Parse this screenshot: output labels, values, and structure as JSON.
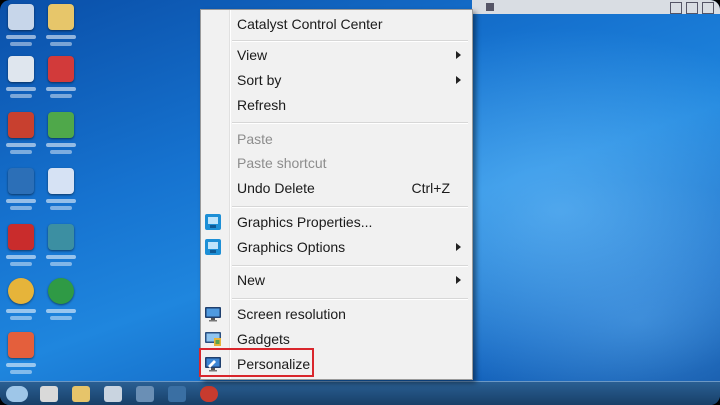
{
  "desktop": {
    "icons": [
      {
        "name": "computer-icon",
        "color": "#c7d6ea"
      },
      {
        "name": "folder-icon",
        "color": "#e7c66a"
      },
      {
        "name": "recycle-bin-icon",
        "color": "#dfe6ee"
      },
      {
        "name": "app-icon-red",
        "color": "#c8402f"
      },
      {
        "name": "app-icon-red-2",
        "color": "#d23a3a"
      },
      {
        "name": "app-icon-green",
        "color": "#4fa84a"
      },
      {
        "name": "app-icon-blue",
        "color": "#2c6fb7"
      },
      {
        "name": "mail-icon",
        "color": "#d6e2f4"
      },
      {
        "name": "app-icon-red-3",
        "color": "#c92c2c"
      },
      {
        "name": "app-icon-teal",
        "color": "#3c8fa2"
      },
      {
        "name": "chrome-icon",
        "color": "#e6b43a"
      },
      {
        "name": "app-icon-green-2",
        "color": "#2f9a45"
      },
      {
        "name": "app-icon-multicolor",
        "color": "#e45f3c"
      }
    ]
  },
  "context_menu": {
    "header": {
      "label": "Catalyst Control Center"
    },
    "view": {
      "label": "View",
      "has_submenu": true
    },
    "sort_by": {
      "label": "Sort by",
      "has_submenu": true
    },
    "refresh": {
      "label": "Refresh"
    },
    "paste": {
      "label": "Paste",
      "disabled": true
    },
    "paste_shortcut": {
      "label": "Paste shortcut",
      "disabled": true
    },
    "undo_delete": {
      "label": "Undo Delete",
      "shortcut": "Ctrl+Z"
    },
    "graphics_properties": {
      "label": "Graphics Properties...",
      "icon": "graphics-icon"
    },
    "graphics_options": {
      "label": "Graphics Options",
      "icon": "graphics-icon",
      "has_submenu": true
    },
    "new": {
      "label": "New",
      "has_submenu": true
    },
    "screen_resolution": {
      "label": "Screen resolution",
      "icon": "monitor-icon"
    },
    "gadgets": {
      "label": "Gadgets",
      "icon": "gadgets-icon"
    },
    "personalize": {
      "label": "Personalize",
      "icon": "personalize-icon",
      "highlighted": true
    }
  },
  "colors": {
    "highlight_box": "#d9262c",
    "graphics_icon": "#1d8fd6",
    "monitor_icon": "#2a6fbf"
  }
}
